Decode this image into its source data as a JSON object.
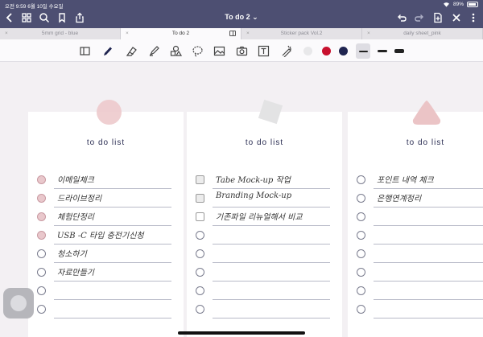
{
  "status": {
    "time_date": "오전 9:59  6월 10일 수요일",
    "battery": "89%"
  },
  "title": "To do 2",
  "title_chevron": "⌄",
  "tabs": [
    {
      "label": "5mm grid - blue",
      "active": false
    },
    {
      "label": "To do 2",
      "active": true
    },
    {
      "label": "Sticker pack Vol.2",
      "active": false
    },
    {
      "label": "daily sheet_pink",
      "active": false
    }
  ],
  "tab_close_glyph": "×",
  "toolbar": {
    "tools": [
      "read-mode-icon",
      "pen-icon",
      "eraser-icon",
      "highlighter-icon",
      "shapes-icon",
      "lasso-icon",
      "image-icon",
      "camera-icon",
      "text-icon",
      "laser-pointer-icon"
    ],
    "colors": [
      "#e8e8ea",
      "#c8102e",
      "#1f2450"
    ],
    "strokes": [
      "thin",
      "medium",
      "thick"
    ],
    "selected_stroke": "thin"
  },
  "cards": [
    {
      "title": "to do list",
      "deco_shape": "circle",
      "items": [
        {
          "text": "이메일체크",
          "check": "filled"
        },
        {
          "text": "드라이브정리",
          "check": "filled"
        },
        {
          "text": "체험단정리",
          "check": "filled"
        },
        {
          "text": "USB -C 타입 충전기신청",
          "check": "filled"
        },
        {
          "text": "청소하기",
          "check": "empty"
        },
        {
          "text": "자료만들기",
          "check": "empty"
        },
        {
          "text": "",
          "check": "empty"
        },
        {
          "text": "",
          "check": "empty"
        }
      ]
    },
    {
      "title": "to do list",
      "deco_shape": "square",
      "items": [
        {
          "text": "Tabe Mock-up 작업",
          "check": "sqfilled"
        },
        {
          "text": "Branding Mock-up",
          "check": "sqfilled"
        },
        {
          "text": "기존파일 리뉴얼해서 비교",
          "check": "sq"
        },
        {
          "text": "",
          "check": "empty"
        },
        {
          "text": "",
          "check": "empty"
        },
        {
          "text": "",
          "check": "empty"
        },
        {
          "text": "",
          "check": "empty"
        },
        {
          "text": "",
          "check": "empty"
        }
      ]
    },
    {
      "title": "to do list",
      "deco_shape": "triangle",
      "items": [
        {
          "text": "포인트 내역 체크",
          "check": "empty"
        },
        {
          "text": "은행연계정리",
          "check": "empty"
        },
        {
          "text": "",
          "check": "empty"
        },
        {
          "text": "",
          "check": "empty"
        },
        {
          "text": "",
          "check": "empty"
        },
        {
          "text": "",
          "check": "empty"
        },
        {
          "text": "",
          "check": "empty"
        },
        {
          "text": "",
          "check": "empty"
        }
      ]
    }
  ]
}
